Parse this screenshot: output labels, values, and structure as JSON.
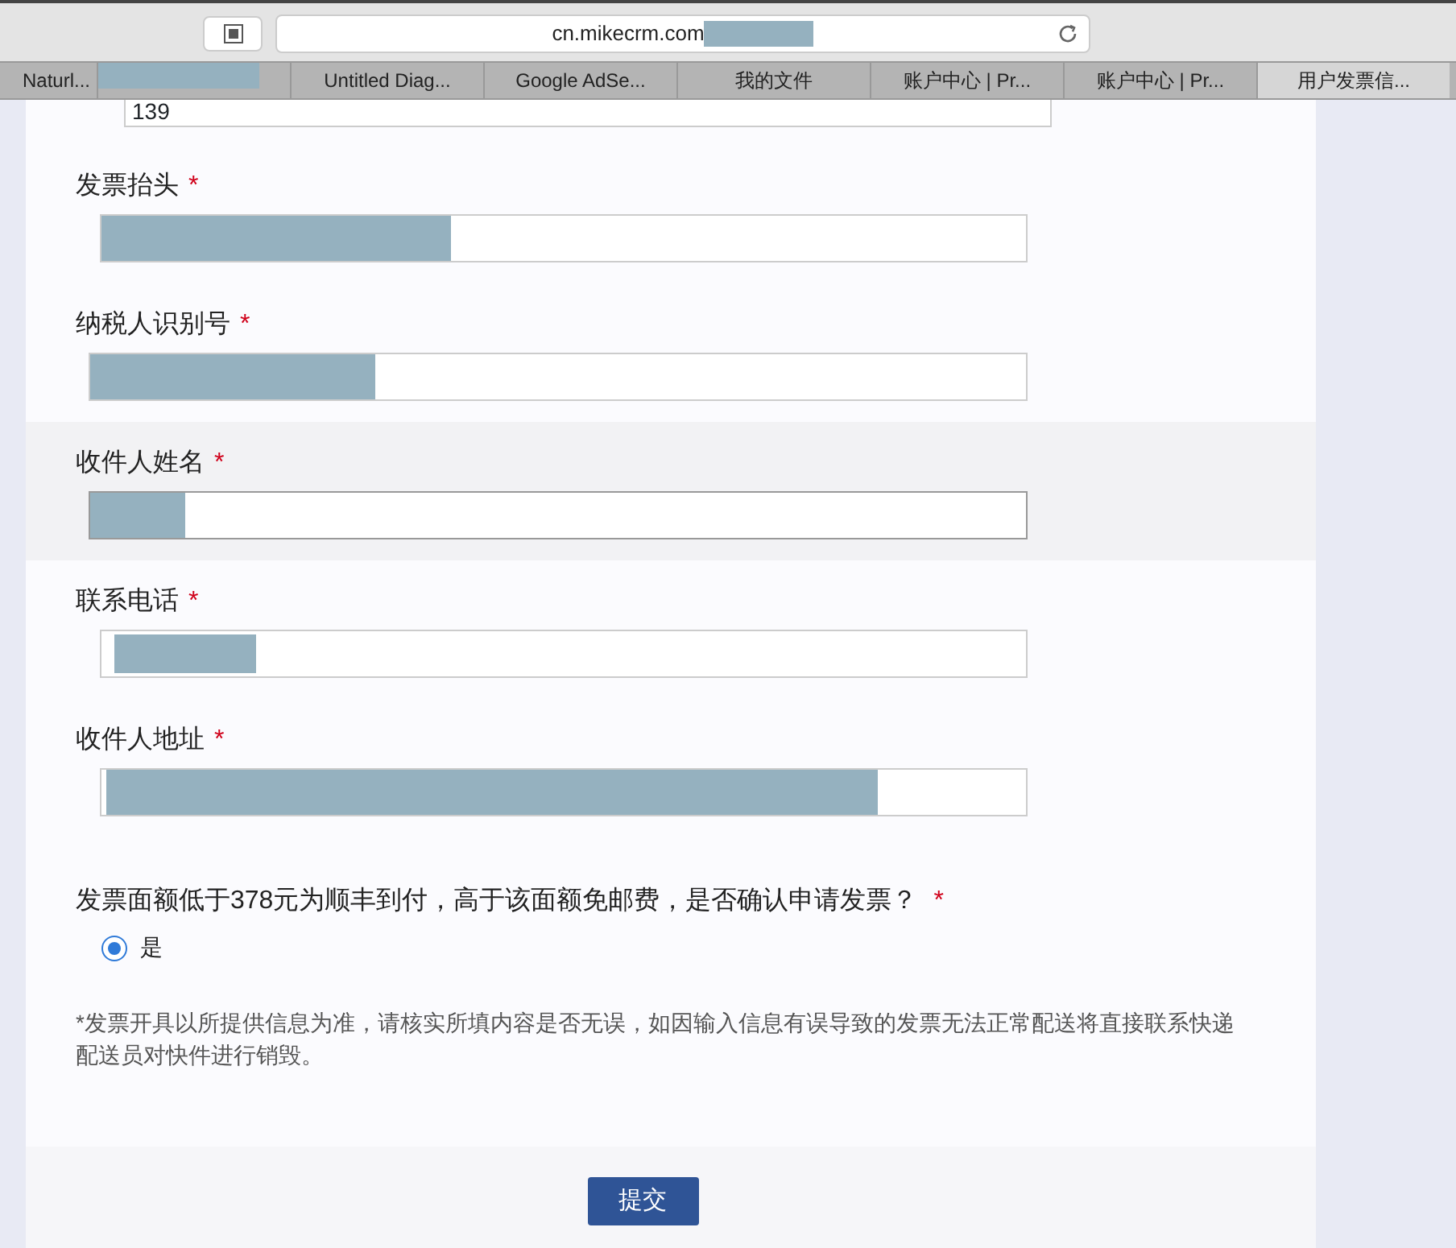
{
  "browser": {
    "url": "cn.mikecrm.com",
    "tabs": [
      {
        "label": "Naturl...",
        "selected": false
      },
      {
        "selected": false,
        "redacted": true
      },
      {
        "label": "Untitled Diag...",
        "selected": false
      },
      {
        "label": "Google AdSe...",
        "selected": false
      },
      {
        "label": "我的文件",
        "selected": false
      },
      {
        "label": "账户中心 | Pr...",
        "selected": false
      },
      {
        "label": "账户中心 | Pr...",
        "selected": false
      },
      {
        "label": "用户发票信...",
        "selected": true
      }
    ]
  },
  "form": {
    "partial_value": "139",
    "fields": [
      {
        "label": "发票抬头",
        "required_mark": "*",
        "highlighted": false
      },
      {
        "label": "纳税人识别号",
        "required_mark": "*",
        "highlighted": false
      },
      {
        "label": "收件人姓名",
        "required_mark": "*",
        "highlighted": true
      },
      {
        "label": "联系电话",
        "required_mark": "*",
        "highlighted": false
      },
      {
        "label": "收件人地址",
        "required_mark": "*",
        "highlighted": false
      }
    ],
    "question": {
      "label": "发票面额低于378元为顺丰到付，高于该面额免邮费，是否确认申请发票？",
      "required_mark": "*",
      "options": [
        {
          "label": "是",
          "selected": true
        }
      ]
    },
    "note": "*发票开具以所提供信息为准，请核实所填内容是否无误，如因输入信息有误导致的发票无法正常配送将直接联系快递配送员对快件进行销毁。",
    "submit": "提交"
  }
}
